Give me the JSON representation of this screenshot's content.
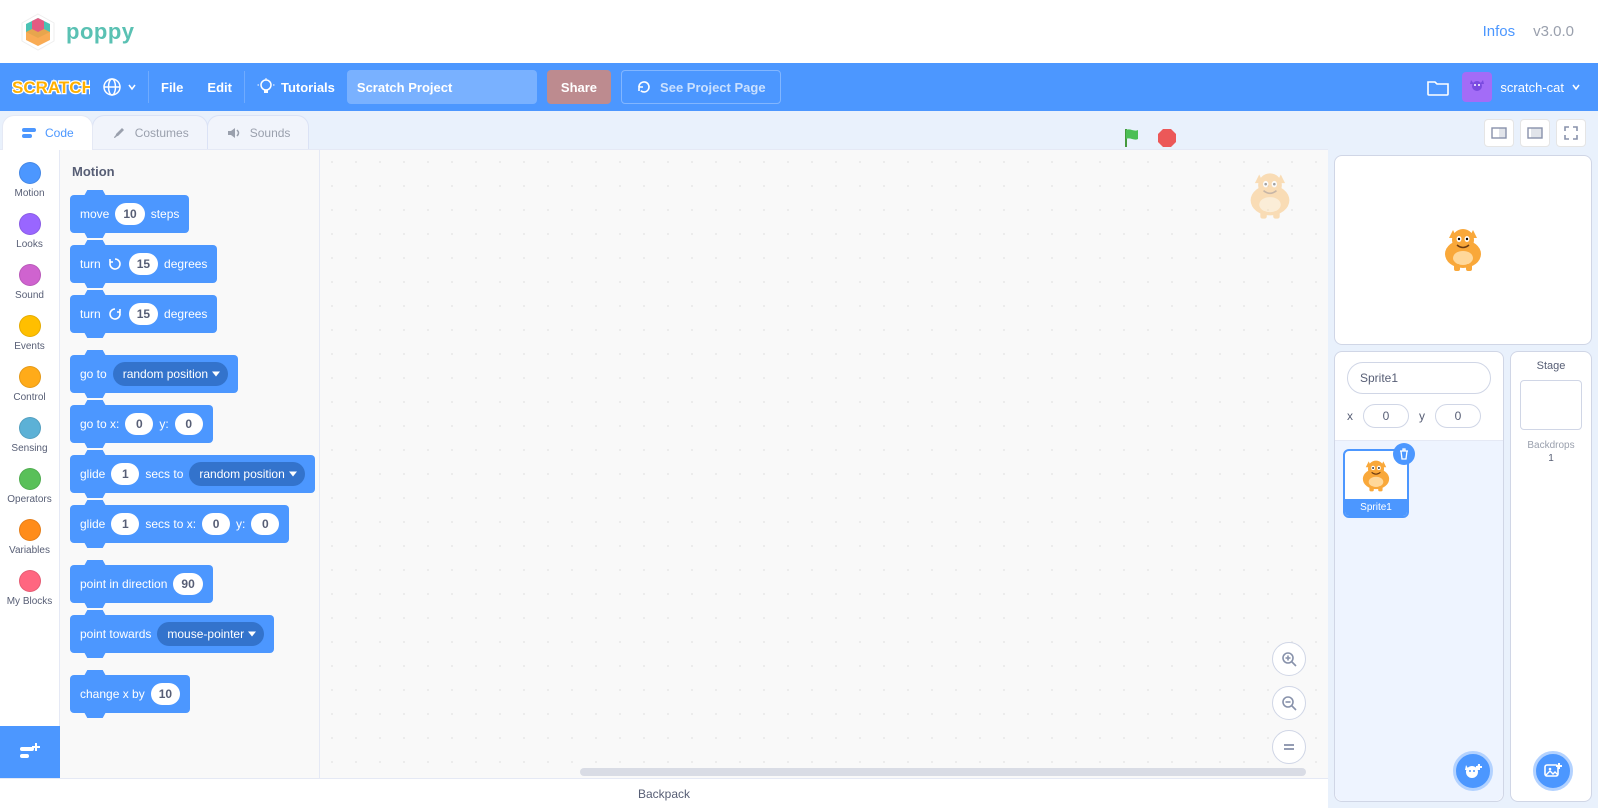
{
  "poppy": {
    "name": "poppy",
    "infos": "Infos",
    "version": "v3.0.0"
  },
  "menu": {
    "file": "File",
    "edit": "Edit",
    "tutorials": "Tutorials",
    "project_title": "Scratch Project",
    "share": "Share",
    "see_project": "See Project Page",
    "username": "scratch-cat"
  },
  "tabs": {
    "code": "Code",
    "costumes": "Costumes",
    "sounds": "Sounds"
  },
  "categories": [
    {
      "id": "motion",
      "label": "Motion",
      "color": "#4c97ff"
    },
    {
      "id": "looks",
      "label": "Looks",
      "color": "#9966ff"
    },
    {
      "id": "sound",
      "label": "Sound",
      "color": "#cf63cf"
    },
    {
      "id": "events",
      "label": "Events",
      "color": "#ffbf00"
    },
    {
      "id": "control",
      "label": "Control",
      "color": "#ffab19"
    },
    {
      "id": "sensing",
      "label": "Sensing",
      "color": "#5cb1d6"
    },
    {
      "id": "operators",
      "label": "Operators",
      "color": "#59c059"
    },
    {
      "id": "variables",
      "label": "Variables",
      "color": "#ff8c1a"
    },
    {
      "id": "myblocks",
      "label": "My Blocks",
      "color": "#ff6680"
    }
  ],
  "palette": {
    "heading": "Motion",
    "blocks": {
      "move": {
        "pre": "move",
        "v": "10",
        "post": "steps"
      },
      "turn_cw": {
        "pre": "turn",
        "v": "15",
        "post": "degrees",
        "icon": "cw"
      },
      "turn_ccw": {
        "pre": "turn",
        "v": "15",
        "post": "degrees",
        "icon": "ccw"
      },
      "goto": {
        "pre": "go to",
        "drop": "random position"
      },
      "goto_xy": {
        "pre": "go to x:",
        "x": "0",
        "mid": "y:",
        "y": "0"
      },
      "glide_to": {
        "pre": "glide",
        "secs": "1",
        "mid": "secs to",
        "drop": "random position"
      },
      "glide_xy": {
        "pre": "glide",
        "secs": "1",
        "mid": "secs to x:",
        "x": "0",
        "mid2": "y:",
        "y": "0"
      },
      "point_dir": {
        "pre": "point in direction",
        "v": "90"
      },
      "point_towards": {
        "pre": "point towards",
        "drop": "mouse-pointer"
      },
      "change_x": {
        "pre": "change x by",
        "v": "10"
      }
    }
  },
  "sprite_info": {
    "name": "Sprite1",
    "x_label": "x",
    "x": "0",
    "y_label": "y",
    "y": "0"
  },
  "sprite_tile": {
    "name": "Sprite1"
  },
  "stage_panel": {
    "title": "Stage",
    "backdrops_label": "Backdrops",
    "count": "1"
  },
  "backpack": "Backpack"
}
